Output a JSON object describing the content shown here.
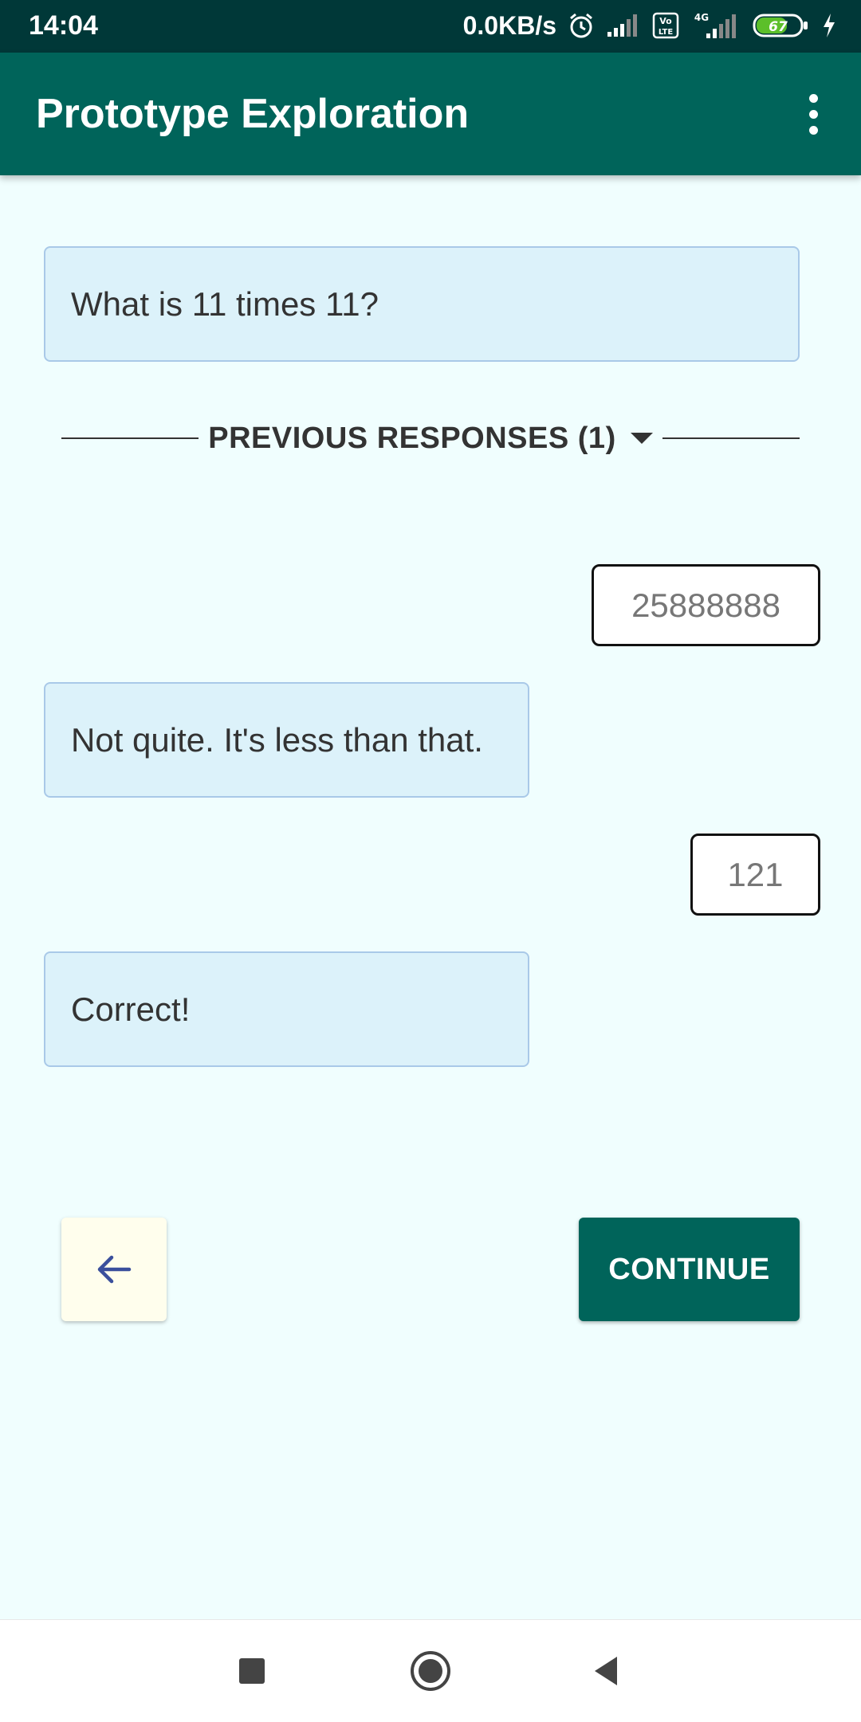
{
  "status_bar": {
    "time": "14:04",
    "network_speed": "0.0KB/s",
    "battery_level": "67",
    "network_type": "4G",
    "volte_label": "Vo LTE"
  },
  "app_bar": {
    "title": "Prototype Exploration"
  },
  "question": {
    "text": "What is 11 times 11?"
  },
  "previous_responses": {
    "label": "PREVIOUS RESPONSES (1)"
  },
  "conversation": {
    "answer_1": "25888888",
    "feedback_1": "Not quite. It's less than that.",
    "answer_2": "121",
    "feedback_2": "Correct!"
  },
  "actions": {
    "continue_label": "CONTINUE"
  },
  "colors": {
    "status_bar_bg": "#003838",
    "app_bar_bg": "#00645a",
    "page_bg": "#f0fefe",
    "card_bg": "#dcf2fa",
    "card_border": "#a9c9e8",
    "back_button_bg": "#fffeed",
    "back_arrow": "#3a4f9c"
  }
}
